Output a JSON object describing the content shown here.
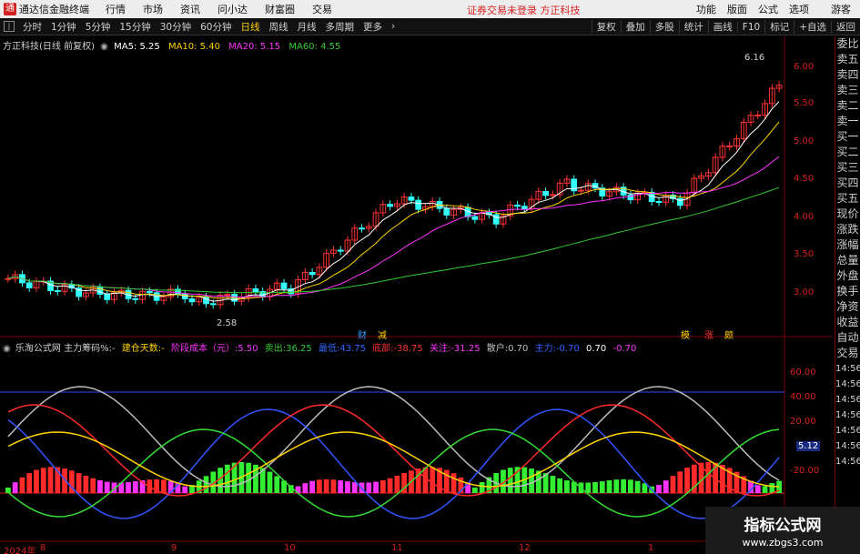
{
  "titlebar": {
    "app_name": "通达信金融终端",
    "menus": [
      "行情",
      "市场",
      "资讯",
      "问小达",
      "财富圈",
      "交易"
    ],
    "center_message": "证券交易未登录  方正科技",
    "right_menus": [
      "功能",
      "版面",
      "公式",
      "选项"
    ],
    "guest": "游客"
  },
  "toolbar": {
    "periods": [
      "分时",
      "1分钟",
      "5分钟",
      "15分钟",
      "30分钟",
      "60分钟",
      "日线",
      "周线",
      "月线",
      "多周期",
      "更多"
    ],
    "active_period": "日线",
    "right_tools": [
      "复权",
      "叠加",
      "多股",
      "统计",
      "画线",
      "F10",
      "标记",
      "+自选",
      "返回"
    ]
  },
  "main_chart": {
    "title": "方正科技(日线 前复权)",
    "ma": [
      {
        "label": "MA5: 5.25",
        "color": "#ffffff"
      },
      {
        "label": "MA10: 5.40",
        "color": "#ffd200"
      },
      {
        "label": "MA20: 5.15",
        "color": "#ff33ff"
      },
      {
        "label": "MA60: 4.55",
        "color": "#33cc33"
      }
    ],
    "high_label": "6.16",
    "low_label": "2.58",
    "y_ticks": [
      "6.00",
      "5.50",
      "5.00",
      "4.50",
      "4.00",
      "3.50",
      "3.00"
    ],
    "y_values": [
      6.0,
      5.5,
      5.0,
      4.5,
      4.0,
      3.5,
      3.0
    ],
    "ylim": [
      2.4,
      6.4
    ],
    "event_markers": [
      "财",
      "减",
      "模",
      "涨",
      "颇"
    ]
  },
  "indicator": {
    "title": "乐淘公式网 主力筹码%:-",
    "items": [
      {
        "label": "建仓天数:-",
        "color": "#ffd200"
      },
      {
        "label": "阶段成本（元）:5.50",
        "color": "#ff33ff"
      },
      {
        "label": "卖出:36.25",
        "color": "#33cc33"
      },
      {
        "label": "最低:43.75",
        "color": "#3366ff"
      },
      {
        "label": "底部:-38.75",
        "color": "#ff3333"
      },
      {
        "label": "关注:-31.25",
        "color": "#ff33ff"
      },
      {
        "label": "散户:0.70",
        "color": "#c0c0c0"
      },
      {
        "label": "主力:-0.70",
        "color": "#3366ff"
      },
      {
        "label": "0.70",
        "color": "#ffffff"
      },
      {
        "label": "-0.70",
        "color": "#ff33ff"
      }
    ],
    "y_ticks": [
      "60.00",
      "40.00",
      "20.00",
      "-20.00"
    ],
    "current_value": "5.12"
  },
  "x_axis": {
    "labels": [
      "2024年",
      "8",
      "9",
      "10",
      "11",
      "12",
      "1"
    ]
  },
  "sidebar": {
    "items": [
      "委比",
      "卖五",
      "卖四",
      "卖三",
      "卖二",
      "卖一",
      "买一",
      "买二",
      "买三",
      "买四",
      "买五",
      "现价",
      "涨跌",
      "涨幅",
      "总量",
      "外盘",
      "换手",
      "净资",
      "收益",
      "自动",
      "交易"
    ],
    "times": [
      "14:56",
      "14:56",
      "14:56",
      "14:56",
      "14:56",
      "14:56",
      "14:56"
    ]
  },
  "watermark": {
    "title": "指标公式网",
    "url": "www.zbgs3.com"
  }
}
